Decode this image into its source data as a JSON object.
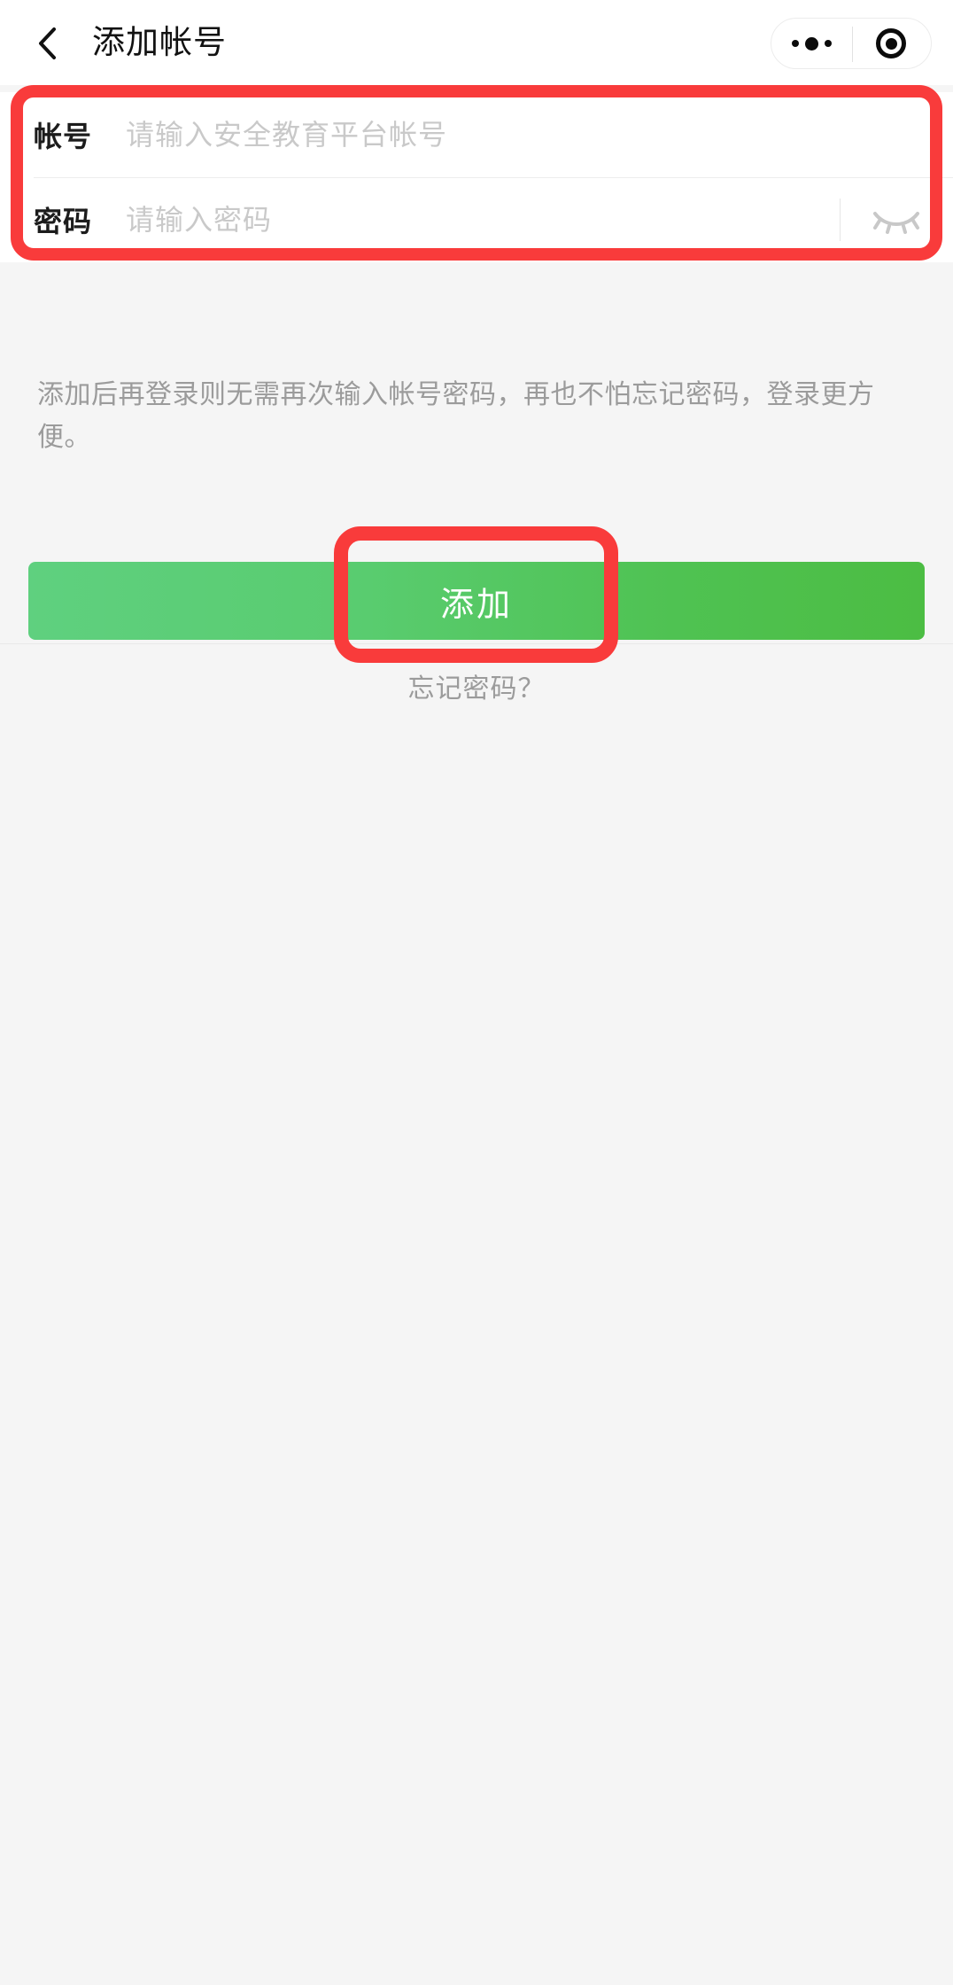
{
  "header": {
    "title": "添加帐号",
    "back_icon": "chevron-left-icon",
    "capsule": {
      "menu_icon": "more-dots-icon",
      "target_icon": "target-circle-icon"
    }
  },
  "form": {
    "fields": [
      {
        "label": "帐号",
        "placeholder": "请输入安全教育平台帐号",
        "value": "",
        "name": "account"
      },
      {
        "label": "密码",
        "placeholder": "请输入密码",
        "value": "",
        "name": "password",
        "toggle_icon": "eye-closed-icon"
      }
    ]
  },
  "hint": "添加后再登录则无需再次输入帐号密码，再也不怕忘记密码，登录更方便。",
  "actions": {
    "submit_label": "添加",
    "forgot_label": "忘记密码？"
  },
  "colors": {
    "highlight": "#f93b3b",
    "button_gradient_start": "#5fd07f",
    "button_gradient_end": "#4cbd43",
    "page_background": "#f5f5f5",
    "hint_text": "#9b9b9b",
    "placeholder": "#c9c9c9"
  }
}
